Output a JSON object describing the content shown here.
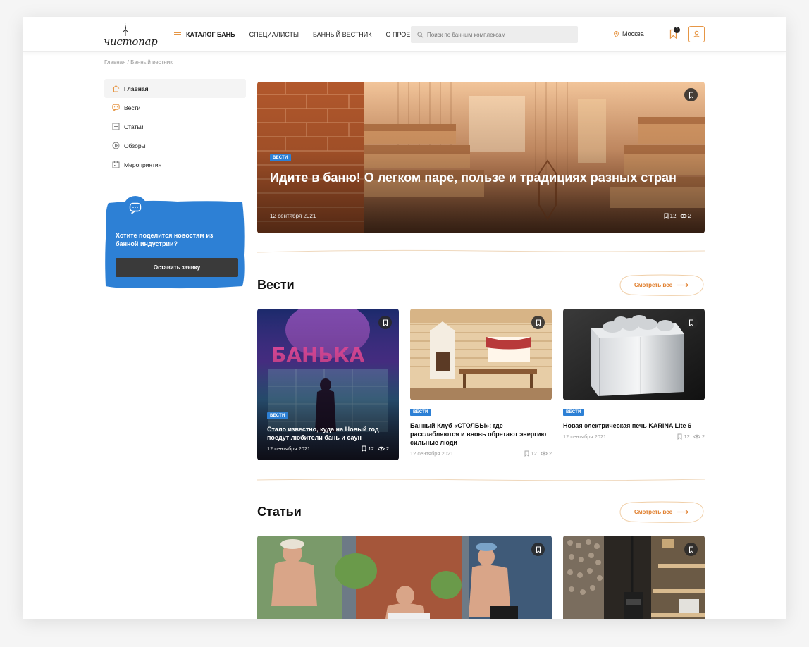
{
  "header": {
    "logo_text": "чистопар",
    "nav": [
      {
        "label": "КАТАЛОГ БАНЬ"
      },
      {
        "label": "СПЕЦИАЛИСТЫ"
      },
      {
        "label": "БАННЫЙ ВЕСТНИК"
      },
      {
        "label": "О ПРОЕКТЕ"
      }
    ],
    "search_placeholder": "Поиск по банным комплексам",
    "city": "Москва",
    "bookmarks_count": "1"
  },
  "breadcrumb": "Главная / Банный вестник",
  "sidebar": {
    "items": [
      {
        "label": "Главная",
        "icon": "home-icon"
      },
      {
        "label": "Вести",
        "icon": "chat-icon"
      },
      {
        "label": "Статьи",
        "icon": "article-icon"
      },
      {
        "label": "Обзоры",
        "icon": "play-icon"
      },
      {
        "label": "Мероприятия",
        "icon": "calendar-icon"
      }
    ],
    "promo": {
      "text": "Хотите поделится новостям из банной индустрии?",
      "button": "Оставить заявку"
    }
  },
  "hero": {
    "tag": "ВЕСТИ",
    "title": "Идите в баню! О легком паре, пользе и традициях разных стран",
    "date": "12 сентября 2021",
    "saves": "12",
    "views": "2"
  },
  "sections": {
    "news": {
      "title": "Вести",
      "see_all": "Смотреть все",
      "cards": [
        {
          "tag": "ВЕСТИ",
          "title": "Стало известно, куда на Новый год поедут любители бань и саун",
          "date": "12 сентября 2021",
          "saves": "12",
          "views": "2"
        },
        {
          "tag": "ВЕСТИ",
          "title": "Банный Клуб «СТОЛБЫ»: где расслабляются и вновь обретают энергию сильные люди",
          "date": "12 сентября 2021",
          "saves": "12",
          "views": "2"
        },
        {
          "tag": "ВЕСТИ",
          "title": "Новая электрическая печь KARINA Lite 6",
          "date": "12 сентября 2021",
          "saves": "12",
          "views": "2"
        }
      ]
    },
    "articles": {
      "title": "Статьи",
      "see_all": "Смотреть все"
    }
  },
  "colors": {
    "accent": "#e69645",
    "blue": "#2d80d5",
    "dark_button": "#3a3a3a"
  }
}
